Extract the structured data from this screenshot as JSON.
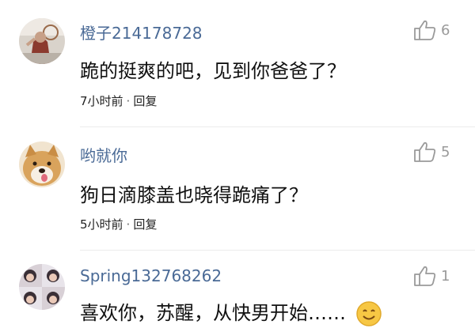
{
  "comments": [
    {
      "username": "橙子214178728",
      "content": "跪的挺爽的吧，见到你爸爸了？",
      "time": "7小时前",
      "reply": "回复",
      "likes": "6",
      "avatar_icon": "child-photo-avatar"
    },
    {
      "username": "哟就你",
      "content": "狗日滴膝盖也晓得跪痛了？",
      "time": "5小时前",
      "reply": "回复",
      "likes": "5",
      "avatar_icon": "shiba-dog-avatar"
    },
    {
      "username": "Spring132768262",
      "content": "喜欢你，苏醒，从快男开始……",
      "likes": "1",
      "avatar_icon": "collage-photo-avatar",
      "emoji": "smile-emoji"
    }
  ],
  "colors": {
    "username": "#4a6a96",
    "content": "#111111",
    "meta": "#222222",
    "like": "#9a9a9a",
    "divider": "#ececec"
  }
}
